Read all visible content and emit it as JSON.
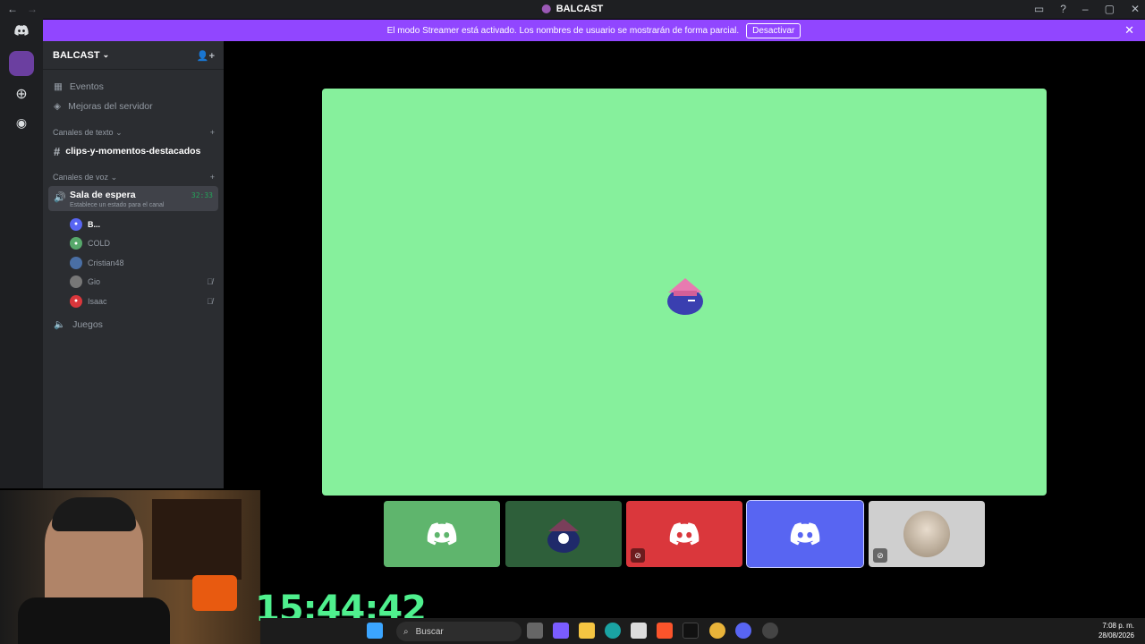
{
  "titlebar": {
    "back": "←",
    "forward": "→",
    "title": "BALCAST"
  },
  "banner": {
    "message": "El modo Streamer está activado. Los nombres de usuario se mostrarán de forma parcial.",
    "button": "Desactivar",
    "close": "✕"
  },
  "server": {
    "name": "BALCAST"
  },
  "sidebar": {
    "links": [
      {
        "label": "Eventos"
      },
      {
        "label": "Mejoras del servidor"
      }
    ],
    "text_category": "Canales de texto",
    "text_channels": [
      {
        "name": "clips-y-momentos-destacados"
      }
    ],
    "voice_category": "Canales de voz",
    "active_voice": {
      "name": "Sala de espera",
      "status": "Establece un estado para el canal",
      "time": "32:33"
    },
    "users": [
      {
        "name": "B...",
        "color": "#5865f2"
      },
      {
        "name": "COLD",
        "color": "#57a86b"
      },
      {
        "name": "Cristian48",
        "color": "#888888"
      },
      {
        "name": "Gio",
        "color": "#777777"
      },
      {
        "name": "Isaac",
        "color": "#da373c"
      }
    ],
    "other_voice": {
      "name": "Juegos"
    }
  },
  "tiles": [
    {
      "color": "#5fb56d",
      "muted": false
    },
    {
      "color": "#2e5f3a",
      "muted": false
    },
    {
      "color": "#da373c",
      "muted": true
    },
    {
      "color": "#5865f2",
      "muted": false
    },
    {
      "color": "#cfcfcf",
      "muted": true
    }
  ],
  "overlay": {
    "timer": "15:44:42"
  },
  "taskbar": {
    "search_placeholder": "Buscar",
    "time": "7:08 p. m.",
    "date": "28/08/2026"
  }
}
